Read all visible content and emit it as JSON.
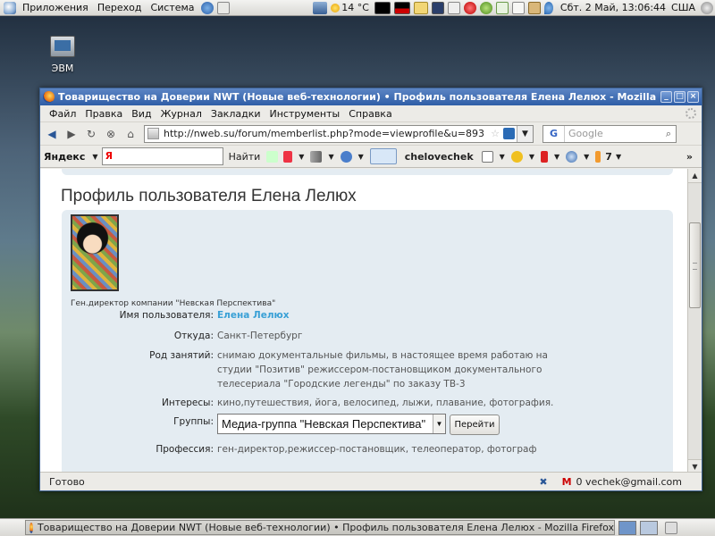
{
  "top_panel": {
    "menus": [
      "Приложения",
      "Переход",
      "Система"
    ],
    "temperature": "14 °C",
    "clock": "Сбт.  2 Май, 13:06:44",
    "locale": "США"
  },
  "desktop": {
    "icon_label": "ЭВМ"
  },
  "window": {
    "title": "Товарищество на Доверии NWT (Новые веб-технологии) • Профиль пользователя Елена Лелюх - Mozilla Firefox",
    "buttons": [
      "_",
      "□",
      "×"
    ]
  },
  "menubar": [
    "Файл",
    "Правка",
    "Вид",
    "Журнал",
    "Закладки",
    "Инструменты",
    "Справка"
  ],
  "navbar": {
    "url": "http://nweb.su/forum/memberlist.php?mode=viewprofile&u=893",
    "search_placeholder": "Google",
    "search_engine_letter": "G"
  },
  "yandexbar": {
    "logo": "Яндекс",
    "input_value": "Я",
    "find_label": "Найти",
    "username": "chelovechek",
    "count": "7"
  },
  "page": {
    "title": "Профиль пользователя Елена Лелюх",
    "avatar_caption": "Ген.директор компании \"Невская Перспектива\"",
    "fields": {
      "username_label": "Имя пользователя:",
      "username_value": "Елена Лелюх",
      "from_label": "Откуда:",
      "from_value": "Санкт-Петербург",
      "occupation_label": "Род занятий:",
      "occupation_lines": [
        "снимаю документальные фильмы, в настоящее время работаю на",
        "студии \"Позитив\" режиссером-постановщиком документального",
        "телесериала \"Городские легенды\" по заказу ТВ-3"
      ],
      "interests_label": "Интересы:",
      "interests_value": "кино,путешествия, йога, велосипед, лыжи, плавание, фотография.",
      "groups_label": "Группы:",
      "groups_selected": "Медиа-группа \"Невская Перспектива\"",
      "go_button": "Перейти",
      "profession_label": "Профессия:",
      "profession_value": "ген-директор,режиссер-постановщик, телеоператор, фотограф"
    }
  },
  "statusbar": {
    "text": "Готово",
    "mail": "0 vechek@gmail.com"
  },
  "taskbar": {
    "task_title": "Товарищество на Доверии NWT (Новые веб-технологии) • Профиль пользователя Елена Лелюх - Mozilla Firefox"
  }
}
